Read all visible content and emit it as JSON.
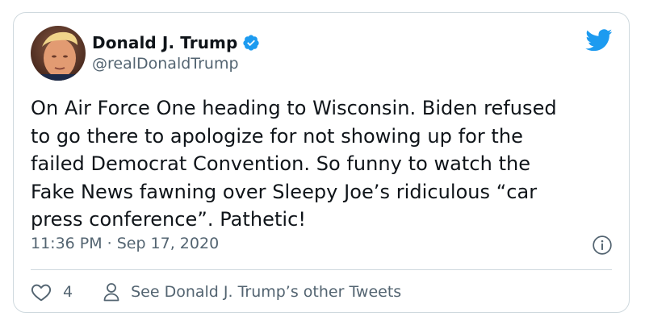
{
  "tweet": {
    "display_name": "Donald J. Trump",
    "handle": "@realDonaldTrump",
    "text": "On Air Force One heading to Wisconsin. Biden refused\nto go there to apologize for not showing up for the\nfailed Democrat Convention. So funny to watch the\nFake News fawning over Sleepy Joe’s ridiculous “car\npress conference”. Pathetic!",
    "time": "11:36 PM",
    "separator": "·",
    "date": "Sep 17, 2020",
    "like_count": "4",
    "other_tweets_label": "See Donald J. Trump’s other Tweets"
  },
  "icons": {
    "verified": "verified-badge-icon",
    "brand": "twitter-bird-icon",
    "info": "info-icon",
    "like": "heart-icon",
    "profile": "person-icon"
  },
  "colors": {
    "brand_blue": "#1d9bf0",
    "text_primary": "#0f1419",
    "text_secondary": "#536471",
    "border": "#cfd9de"
  }
}
